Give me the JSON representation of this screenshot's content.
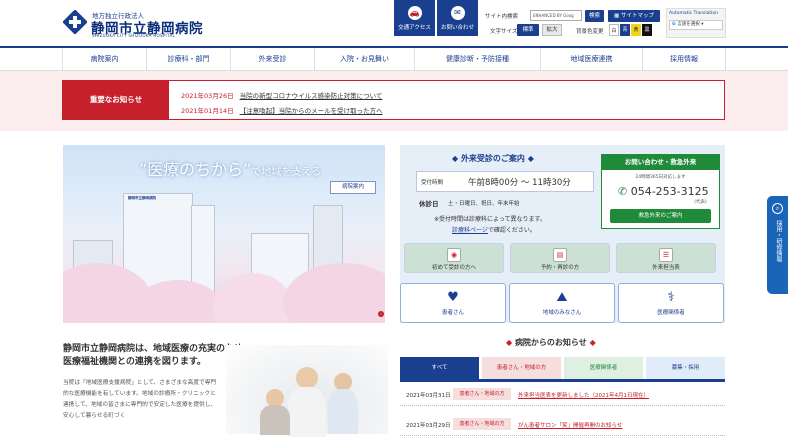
{
  "header": {
    "logo_small": "地方独立行政法人",
    "logo_main": "静岡市立静岡病院",
    "logo_en": "SHIZUOKA CITY SHIZUOKA HOSPITAL",
    "access_label": "交通アクセス",
    "contact_label": "お問い合わせ",
    "site_search_label": "サイト内検索",
    "search_placeholder": "ENHANCED BY Goog",
    "search_button": "検索",
    "sitemap_button": "サイトマップ",
    "font_size_label": "文字サイズ",
    "font_standard": "標準",
    "font_large": "拡大",
    "bg_color_label": "背景色変更",
    "bg_white": "白",
    "bg_blue": "青",
    "bg_yellow": "黄",
    "bg_black": "黒",
    "translation_title": "Automatic Translation",
    "translation_select": "言語を選択"
  },
  "nav": [
    "病院案内",
    "診療科・部門",
    "外来受診",
    "入院・お見舞い",
    "健康診断・予防接種",
    "地域医療連携",
    "採用情報"
  ],
  "notices": {
    "title": "重要なお知らせ",
    "items": [
      {
        "date": "2021年03月26日",
        "text": "当院の新型コロナウイルス感染防止対策について"
      },
      {
        "date": "2021年01月14日",
        "text": "【注意喚起】当院からのメールを受け取った方へ"
      }
    ]
  },
  "hero": {
    "caption_pre": "“医療のちから”",
    "caption_post": "で地域を支える",
    "button": "病院案内",
    "building_sign": "静岡市立静岡病院"
  },
  "outpatient": {
    "title": "外来受診のご案内",
    "reception_label": "受付時間",
    "reception_time": "午前8時00分 ～ 11時30分",
    "closed_label": "休診日",
    "closed_days": "土・日曜日、祝日、年末年始",
    "note1": "※受付時間は診療科によって異なります。",
    "note2_link": "診療科ページ",
    "note2_rest": "で確認ください。"
  },
  "contact": {
    "title": "お問い合わせ・救急外来",
    "hours": "24時間365日対応します",
    "tel": "054-253-3125",
    "tel_note": "(代表)",
    "emergency_button": "救急外来のご案内"
  },
  "guide_buttons": [
    "初めて受診の方へ",
    "予約・再診の方",
    "外来担当表"
  ],
  "audience_buttons": [
    {
      "label": "患者さん",
      "icon": "heart-icon"
    },
    {
      "label": "地域のみなさん",
      "icon": "shizuoka-map-icon"
    },
    {
      "label": "医療関係者",
      "icon": "stethoscope-icon"
    }
  ],
  "intro": {
    "heading_l1": "静岡市立静岡病院は、地域医療の充実のため",
    "heading_l2": "医療福祉機関との連携を図ります。",
    "body": "当院は「地域医療支援病院」として、さまざまな高度で専門的な医療機能を有しています。地域の診療所・クリニックと連携して、地域の皆さまに専門的で安定した医療を提供し、安心して暮らせる町づく"
  },
  "news": {
    "title": "病院からのお知らせ",
    "tabs": [
      "すべて",
      "患者さん・地域の方",
      "医療関係者",
      "募集・採用"
    ],
    "items": [
      {
        "date": "2021年03月31日",
        "category": "患者さん・地域の方",
        "text": "外来担当医表を更新しました（2021年4月1日現在）"
      },
      {
        "date": "2021年03月29日",
        "category": "患者さん・地域の方",
        "text": "がん患者サロン「笑」開催再開のお知らせ"
      }
    ]
  },
  "side_tab": {
    "label": "採用・研修情報"
  },
  "colors": {
    "brand": "#1b3f8f",
    "alert": "#c6202c",
    "green": "#1f8a3a"
  }
}
